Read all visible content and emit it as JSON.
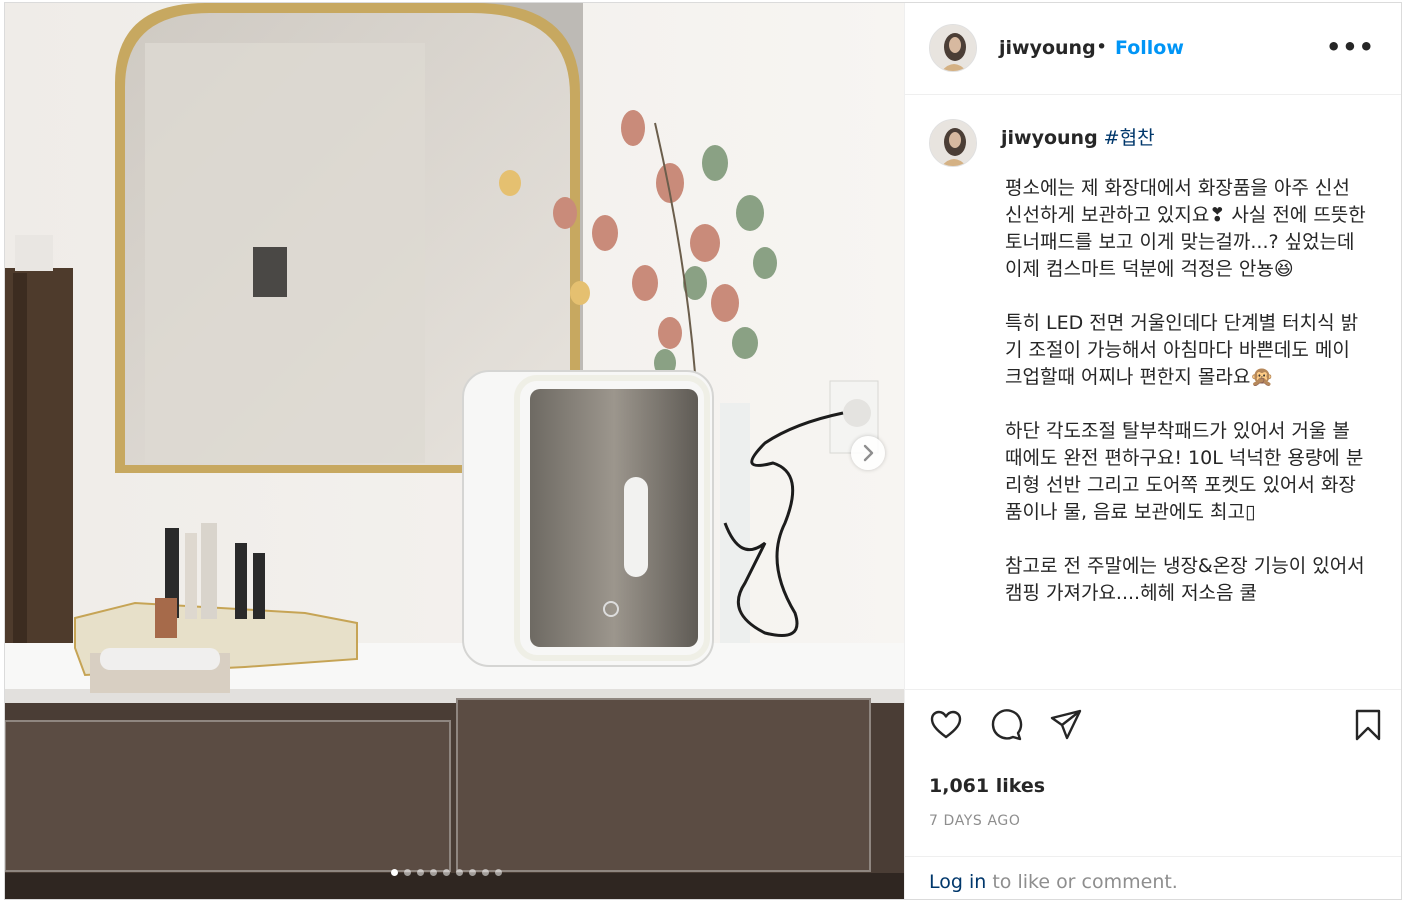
{
  "post": {
    "username": "jiwyoung",
    "separator": "•",
    "follow_label": "Follow",
    "more_label": "•••",
    "caption": {
      "username": "jiwyoung",
      "hashtag": "#협찬",
      "paragraphs": [
        "평소에는 제 화장대에서 화장품을 아주 신선신선하게 보관하고 있지요❣ 사실 전에 뜨뜻한 토너패드를 보고 이게 맞는걸까...? 싶었는데 이제 컴스마트 덕분에 걱정은 안뇽😆",
        "특히 LED 전면 거울인데다 단계별 터치식 밝기 조절이 가능해서 아침마다 바쁜데도 메이크업할때 어찌나 편한지 몰라요🙊",
        "하단 각도조절 탈부착패드가 있어서 거울 볼 때에도 완전 편하구요! 10L 넉넉한 용량에 분리형 선반 그리고 도어쪽 포켓도 있어서 화장품이나 물, 음료 보관에도 최고▯",
        "참고로 전 주말에는 냉장&온장 기능이 있어서 캠핑 가져가요....헤헤 저소음 쿨"
      ]
    },
    "likes": "1,061 likes",
    "time": "7 DAYS AGO",
    "login_link": "Log in",
    "login_rest": " to like or comment.",
    "carousel": {
      "count": 9,
      "active": 0
    }
  },
  "colors": {
    "link_blue": "#0095f6",
    "hashtag": "#00376b",
    "muted": "#8e8e8e"
  },
  "icons": [
    "heart-icon",
    "comment-icon",
    "share-icon",
    "bookmark-icon",
    "chevron-right-icon",
    "more-icon"
  ]
}
